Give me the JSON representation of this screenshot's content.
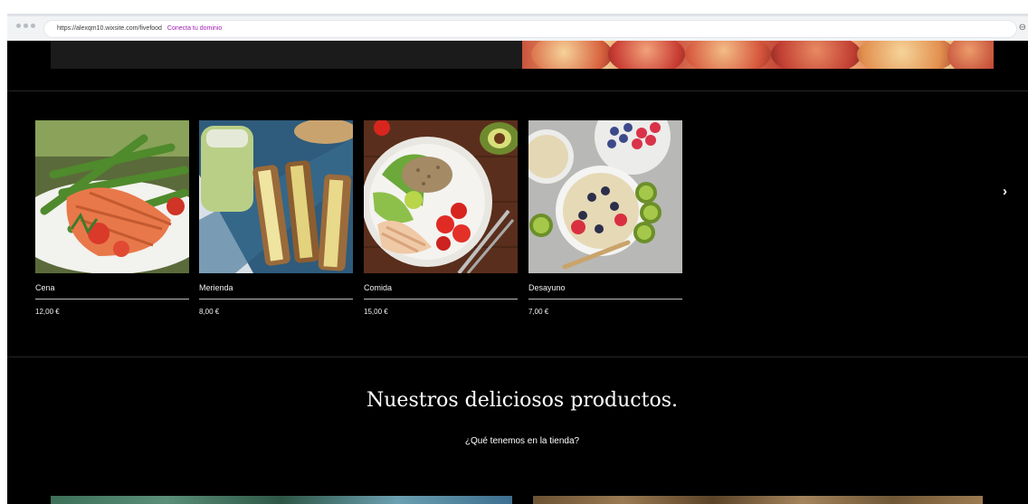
{
  "browser": {
    "url": "https://alexqm10.wixsite.com/fivefood",
    "domain_cta": "Conecta tu dominio"
  },
  "products": [
    {
      "name": "Cena",
      "price": "12,00 €",
      "image": "salmon-asparagus-icon"
    },
    {
      "name": "Merienda",
      "price": "8,00 €",
      "image": "sandwich-smoothie-icon"
    },
    {
      "name": "Comida",
      "price": "15,00 €",
      "image": "chicken-salad-bowl-icon"
    },
    {
      "name": "Desayuno",
      "price": "7,00 €",
      "image": "oatmeal-berries-icon"
    }
  ],
  "section": {
    "title": "Nuestros deliciosos productos.",
    "subtitle": "¿Qué tenemos en la tienda?"
  },
  "colors": {
    "page_bg": "#000000",
    "text": "#ffffff",
    "cta": "#a020b0"
  }
}
